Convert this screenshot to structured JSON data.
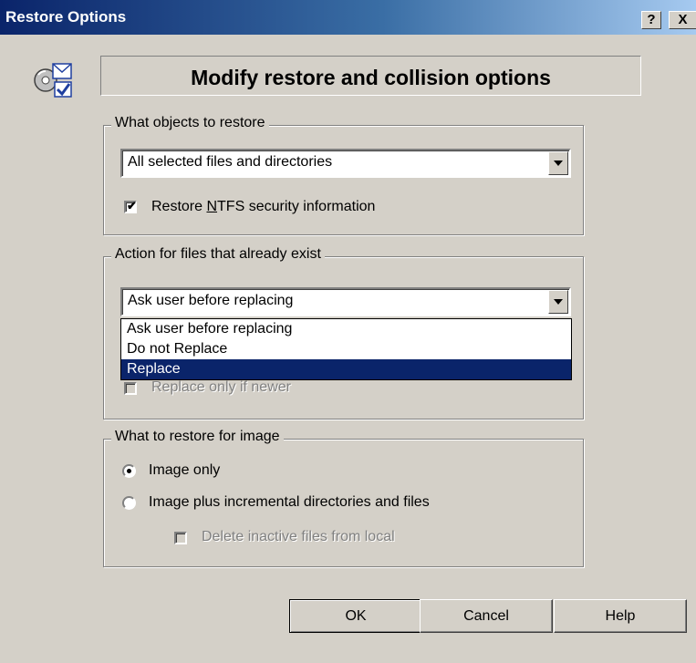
{
  "window": {
    "title": "Restore Options",
    "help_glyph": "?",
    "close_glyph": "X"
  },
  "header": {
    "title": "Modify restore and collision options",
    "icon": "restore-icon"
  },
  "objects_group": {
    "legend": "What objects to restore",
    "selected": "All selected files and directories",
    "ntfs_label_pre": "Restore ",
    "ntfs_label_accel": "N",
    "ntfs_label_post": "TFS security information",
    "ntfs_checked": true
  },
  "action_group": {
    "legend": "Action for files that already exist",
    "selected": "Ask user before replacing",
    "options": [
      "Ask user before replacing",
      "Do not Replace",
      "Replace"
    ],
    "highlighted_option": "Replace",
    "newer_label": "Replace only if newer",
    "newer_checked": false
  },
  "image_group": {
    "legend": "What to restore for image",
    "radio_image_only": "Image only",
    "radio_image_plus": "Image plus incremental directories and files",
    "selected_radio": "Image only",
    "delete_inactive_label": "Delete inactive files from local",
    "delete_inactive_checked": false
  },
  "buttons": {
    "ok": "OK",
    "cancel": "Cancel",
    "help": "Help"
  },
  "colors": {
    "face": "#d4d0c8",
    "titlebar_start": "#0a246a",
    "titlebar_end": "#a6caf0",
    "selection": "#0a246a"
  }
}
